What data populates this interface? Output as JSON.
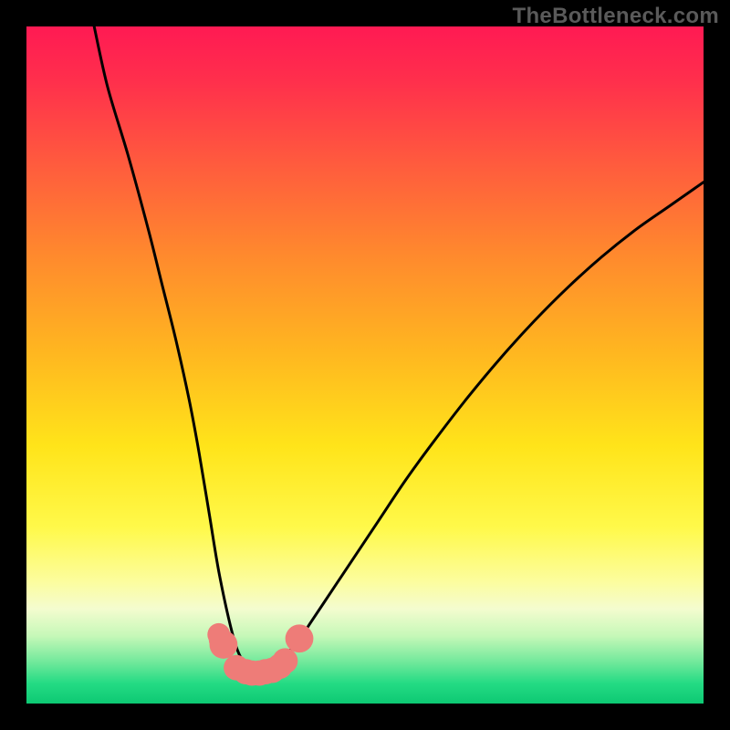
{
  "watermark": "TheBottleneck.com",
  "chart_data": {
    "type": "line",
    "title": "",
    "xlabel": "",
    "ylabel": "",
    "xlim": [
      0,
      100
    ],
    "ylim": [
      0,
      100
    ],
    "grid": false,
    "legend": false,
    "curve": {
      "x": [
        10,
        12,
        15,
        18,
        20,
        22,
        24,
        25.5,
        27,
        28.5,
        30.5,
        31.8,
        33,
        34.5,
        36,
        38,
        40,
        42,
        45,
        48,
        52,
        56,
        60,
        65,
        70,
        75,
        80,
        85,
        90,
        95,
        100
      ],
      "y": [
        100,
        91,
        81,
        70,
        62,
        54,
        45,
        37,
        28,
        19,
        10,
        6.5,
        5,
        5,
        5.5,
        7,
        9,
        12,
        16.5,
        21,
        27,
        33,
        38.5,
        45,
        51,
        56.5,
        61.5,
        66,
        70,
        73.5,
        77
      ]
    },
    "markers": {
      "color": "#ee7c78",
      "points": [
        {
          "x": 28.4,
          "y": 10.2,
          "r": 1.0
        },
        {
          "x": 28.6,
          "y": 9.4,
          "r": 1.0
        },
        {
          "x": 29.1,
          "y": 8.7,
          "r": 1.4
        },
        {
          "x": 31.0,
          "y": 5.3,
          "r": 1.2
        },
        {
          "x": 32.4,
          "y": 4.7,
          "r": 1.2
        },
        {
          "x": 33.3,
          "y": 4.5,
          "r": 1.2
        },
        {
          "x": 34.4,
          "y": 4.5,
          "r": 1.2
        },
        {
          "x": 35.3,
          "y": 4.7,
          "r": 1.2
        },
        {
          "x": 36.3,
          "y": 4.9,
          "r": 1.2
        },
        {
          "x": 37.4,
          "y": 5.5,
          "r": 1.2
        },
        {
          "x": 38.2,
          "y": 6.3,
          "r": 1.2
        },
        {
          "x": 40.3,
          "y": 9.6,
          "r": 1.4
        }
      ]
    },
    "gradient_stops": [
      {
        "pos": 0.0,
        "color": "#ff1a53"
      },
      {
        "pos": 0.2,
        "color": "#ff5a3e"
      },
      {
        "pos": 0.48,
        "color": "#ffb620"
      },
      {
        "pos": 0.74,
        "color": "#fff94a"
      },
      {
        "pos": 0.9,
        "color": "#c6f8b8"
      },
      {
        "pos": 1.0,
        "color": "#0dc973"
      }
    ]
  }
}
